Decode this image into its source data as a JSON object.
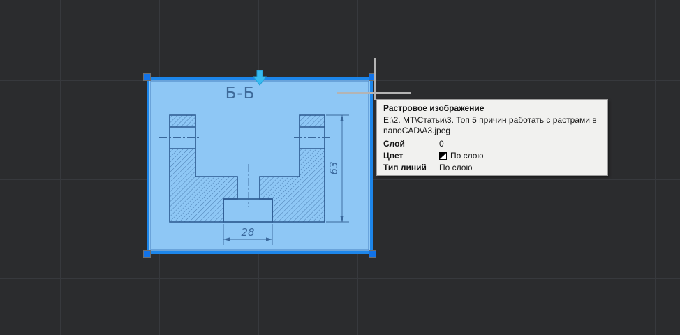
{
  "canvas": {
    "background_color": "#2b2c2e",
    "grid_color": "#37393d"
  },
  "raster_image": {
    "section_label": "Б-Б",
    "dim_height_label": "63",
    "dim_width_label": "28",
    "fill_color": "#8ec7f5",
    "line_color": "#2b588e",
    "selection_border_color": "#1d86ea",
    "grip_color": "#1273e8",
    "arrow_grip_color": "#38bbf0"
  },
  "tooltip": {
    "title": "Растровое изображение",
    "file_path": "E:\\2. МТ\\Статьи\\3. Топ 5 причин работать с растрами в nanoCAD\\A3.jpeg",
    "rows": [
      {
        "label": "Слой",
        "value": "0"
      },
      {
        "label": "Цвет",
        "value": "По слою",
        "swatch_icon": "bylayer-color-swatch-icon"
      },
      {
        "label": "Тип линий",
        "value": "По слою"
      }
    ]
  }
}
